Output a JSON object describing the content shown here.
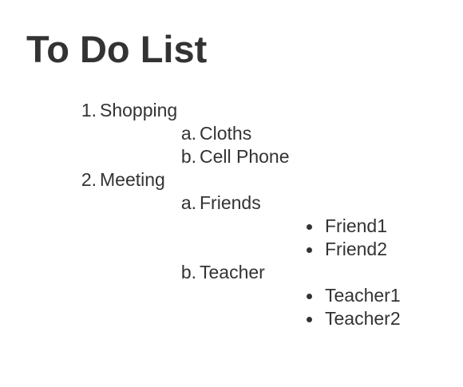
{
  "title": "To Do List",
  "items": [
    {
      "marker": "1.",
      "label": "Shopping",
      "subitems": [
        {
          "marker": "a.",
          "label": "Cloths",
          "children": []
        },
        {
          "marker": "b.",
          "label": "Cell Phone",
          "children": []
        }
      ]
    },
    {
      "marker": "2.",
      "label": "Meeting",
      "subitems": [
        {
          "marker": "a.",
          "label": "Friends",
          "children": [
            "Friend1",
            "Friend2"
          ]
        },
        {
          "marker": "b.",
          "label": "Teacher",
          "children": [
            "Teacher1",
            "Teacher2"
          ]
        }
      ]
    }
  ]
}
